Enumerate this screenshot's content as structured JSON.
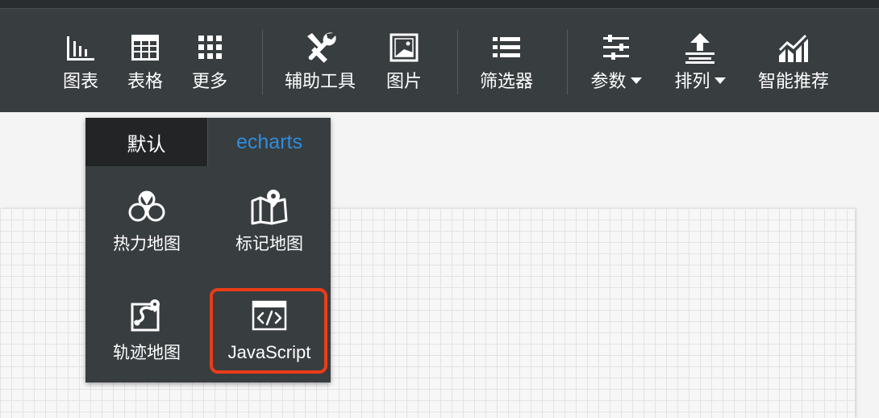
{
  "toolbar": {
    "items": [
      {
        "label": "图表",
        "icon": "bar-chart-icon"
      },
      {
        "label": "表格",
        "icon": "table-icon"
      },
      {
        "label": "更多",
        "icon": "grid-dots-icon"
      },
      {
        "label": "辅助工具",
        "icon": "tools-icon"
      },
      {
        "label": "图片",
        "icon": "image-icon"
      },
      {
        "label": "筛选器",
        "icon": "list-filter-icon"
      },
      {
        "label": "参数",
        "icon": "sliders-icon",
        "dropdown": true
      },
      {
        "label": "排列",
        "icon": "arrange-icon",
        "dropdown": true
      },
      {
        "label": "智能推荐",
        "icon": "smart-chart-icon"
      }
    ]
  },
  "dropdown": {
    "tabs": [
      {
        "label": "默认",
        "active": false
      },
      {
        "label": "echarts",
        "active": true
      }
    ],
    "items": [
      {
        "label": "热力地图",
        "icon": "heatmap-icon"
      },
      {
        "label": "标记地图",
        "icon": "marker-map-icon"
      },
      {
        "label": "轨迹地图",
        "icon": "trajectory-map-icon"
      },
      {
        "label": "JavaScript",
        "icon": "code-window-icon",
        "highlighted": true
      }
    ]
  },
  "colors": {
    "toolbar_bg": "#383d40",
    "accent": "#2d8ddb",
    "highlight": "#ea3d18"
  }
}
